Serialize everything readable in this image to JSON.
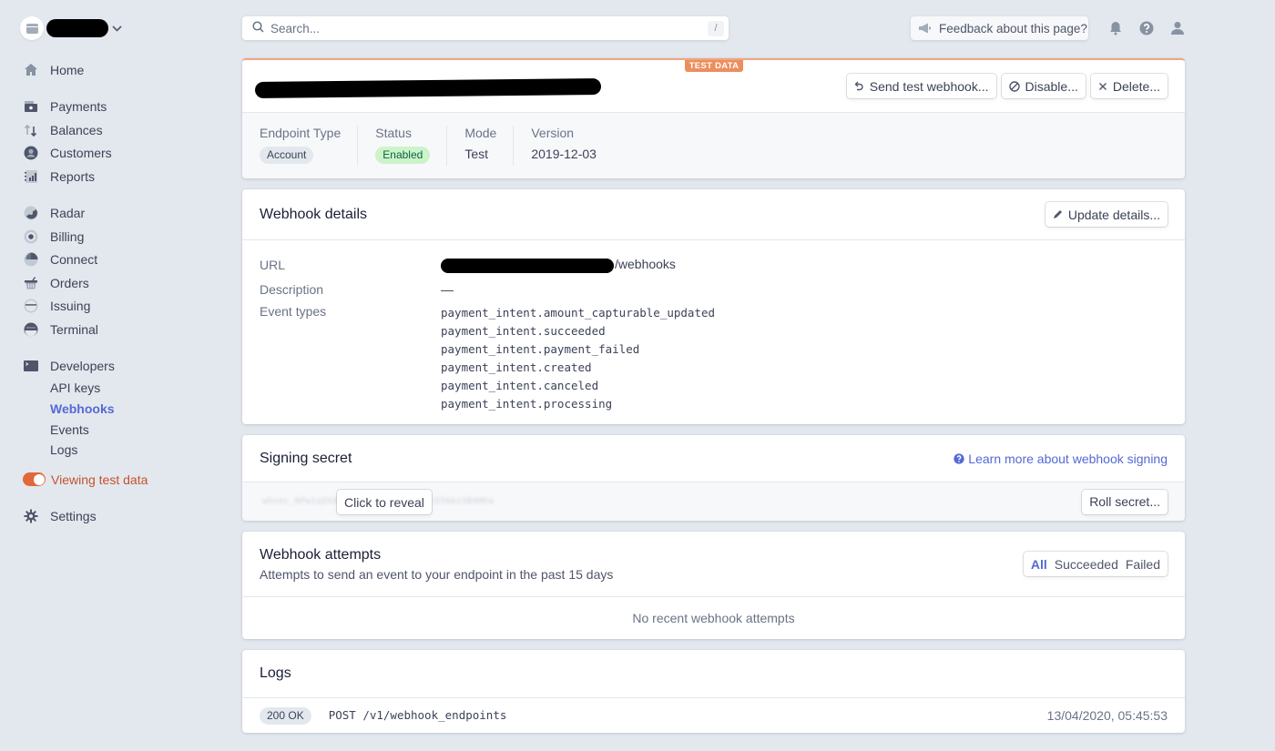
{
  "sidebar": {
    "account_chevron": "chevron-down",
    "items": [
      {
        "label": "Home",
        "icon": "home-icon"
      },
      {
        "label": "Payments",
        "icon": "payments-icon"
      },
      {
        "label": "Balances",
        "icon": "balances-icon"
      },
      {
        "label": "Customers",
        "icon": "customers-icon"
      },
      {
        "label": "Reports",
        "icon": "reports-icon"
      },
      {
        "label": "Radar",
        "icon": "radar-icon"
      },
      {
        "label": "Billing",
        "icon": "billing-icon"
      },
      {
        "label": "Connect",
        "icon": "connect-icon"
      },
      {
        "label": "Orders",
        "icon": "orders-icon"
      },
      {
        "label": "Issuing",
        "icon": "issuing-icon"
      },
      {
        "label": "Terminal",
        "icon": "terminal-icon"
      },
      {
        "label": "Developers",
        "icon": "developers-icon"
      }
    ],
    "developer_sub": [
      {
        "label": "API keys",
        "active": false
      },
      {
        "label": "Webhooks",
        "active": true
      },
      {
        "label": "Events",
        "active": false
      },
      {
        "label": "Logs",
        "active": false
      }
    ],
    "test_toggle": {
      "label": "Viewing test data",
      "on": true
    },
    "settings": {
      "label": "Settings",
      "icon": "gear-icon"
    }
  },
  "topbar": {
    "search_placeholder": "Search...",
    "search_shortcut": "/",
    "feedback_label": "Feedback about this page?"
  },
  "header": {
    "badge": "TEST DATA",
    "buttons": {
      "send_test": "Send test webhook...",
      "disable": "Disable...",
      "delete": "Delete..."
    },
    "meta": [
      {
        "label": "Endpoint Type",
        "value": "Account",
        "style": "pill-gray"
      },
      {
        "label": "Status",
        "value": "Enabled",
        "style": "pill-green"
      },
      {
        "label": "Mode",
        "value": "Test",
        "style": "text"
      },
      {
        "label": "Version",
        "value": "2019-12-03",
        "style": "text"
      }
    ]
  },
  "details": {
    "title": "Webhook details",
    "update_button": "Update details...",
    "url_label": "URL",
    "url_suffix": "/webhooks",
    "description_label": "Description",
    "description_value": "—",
    "event_types_label": "Event types",
    "event_types": [
      "payment_intent.amount_capturable_updated",
      "payment_intent.succeeded",
      "payment_intent.payment_failed",
      "payment_intent.created",
      "payment_intent.canceled",
      "payment_intent.processing"
    ]
  },
  "signing": {
    "title": "Signing secret",
    "learn_more": "Learn more about webhook signing",
    "secret_masked": "whsec_6Pw1qXXXXXXXXXXXXXXXXXXX1rS56bz3B4Hho",
    "reveal_label": "Click to reveal",
    "roll_button": "Roll secret..."
  },
  "attempts": {
    "title": "Webhook attempts",
    "subtitle": "Attempts to send an event to your endpoint in the past 15 days",
    "filters": [
      {
        "label": "All",
        "active": true
      },
      {
        "label": "Succeeded",
        "active": false
      },
      {
        "label": "Failed",
        "active": false
      }
    ],
    "empty_text": "No recent webhook attempts"
  },
  "logs": {
    "title": "Logs",
    "entries": [
      {
        "status": "200 OK",
        "request": "POST /v1/webhook_endpoints",
        "time": "13/04/2020, 05:45:53"
      }
    ]
  },
  "colors": {
    "accent": "#5469d4",
    "test_orange": "#e0683b",
    "enabled_bg": "#cbf4c9",
    "enabled_text": "#0e6245",
    "background": "#e3e8ee"
  }
}
